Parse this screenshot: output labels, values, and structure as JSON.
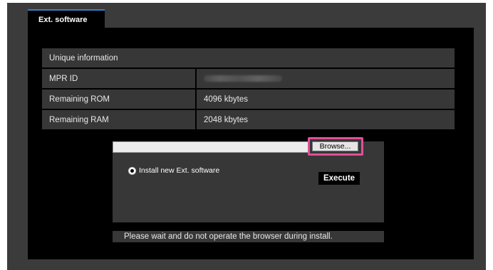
{
  "tab": {
    "label": "Ext. software",
    "accent": "#3a7fc4"
  },
  "info": {
    "header": "Unique information",
    "rows": [
      {
        "label": "MPR ID",
        "value": ""
      },
      {
        "label": "Remaining ROM",
        "value": "4096 kbytes"
      },
      {
        "label": "Remaining RAM",
        "value": "2048 kbytes"
      }
    ]
  },
  "upload": {
    "file_value": "",
    "browse_label": "Browse...",
    "highlight_color": "#e0509a",
    "radio_label": "Install new Ext. software",
    "radio_checked": true,
    "execute_label": "Execute"
  },
  "notice": "Please wait and do not operate the browser during install."
}
